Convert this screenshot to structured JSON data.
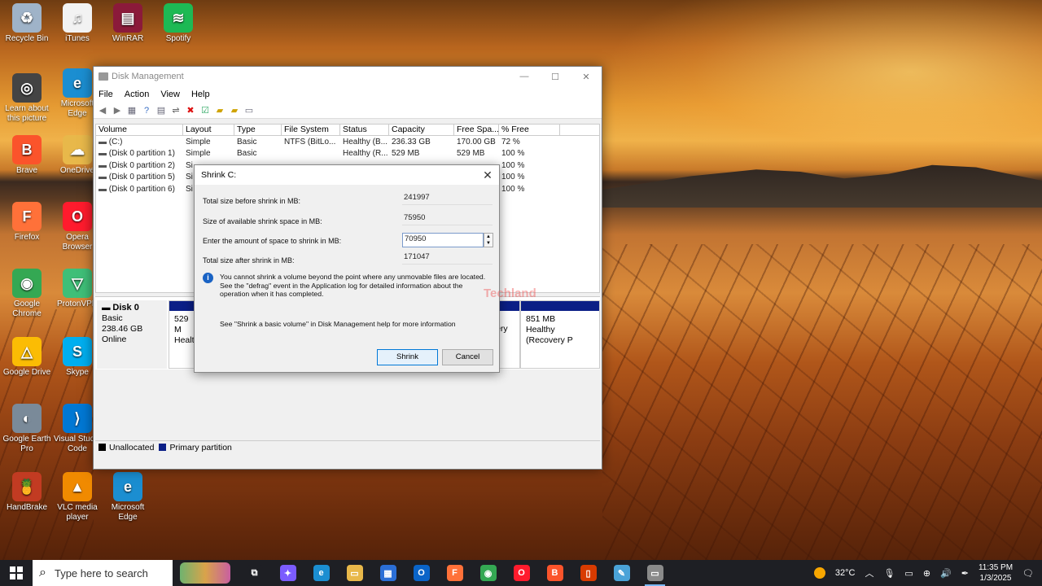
{
  "desktop_icons": [
    {
      "label": "Recycle Bin",
      "color": "#9fb3c8",
      "glyph": "♻"
    },
    {
      "label": "iTunes",
      "color": "#f2f2f2",
      "glyph": "♫"
    },
    {
      "label": "WinRAR",
      "color": "#8b1a3a",
      "glyph": "▤"
    },
    {
      "label": "Spotify",
      "color": "#1db954",
      "glyph": "≋"
    },
    {
      "label": "Learn about this picture",
      "color": "#444444",
      "glyph": "◎"
    },
    {
      "label": "Microsoft Edge",
      "color": "#1b8ed1",
      "glyph": "e"
    },
    {
      "label": "Brave",
      "color": "#fb542b",
      "glyph": "B"
    },
    {
      "label": "OneDrive",
      "color": "#e8b84a",
      "glyph": "☁"
    },
    {
      "label": "Firefox",
      "color": "#ff7139",
      "glyph": "F"
    },
    {
      "label": "Opera Browser",
      "color": "#ff1b2d",
      "glyph": "O"
    },
    {
      "label": "Google Chrome",
      "color": "#34a853",
      "glyph": "◉"
    },
    {
      "label": "ProtonVPN",
      "color": "#3fbf78",
      "glyph": "▽"
    },
    {
      "label": "Google Drive",
      "color": "#fbbc04",
      "glyph": "△"
    },
    {
      "label": "Skype",
      "color": "#00aff0",
      "glyph": "S"
    },
    {
      "label": "Google Earth Pro",
      "color": "#7a8a99",
      "glyph": "◐"
    },
    {
      "label": "Visual Studio Code",
      "color": "#0078d4",
      "glyph": "⟩"
    },
    {
      "label": "HandBrake",
      "color": "#c23b22",
      "glyph": "🍍"
    },
    {
      "label": "VLC media player",
      "color": "#f08a00",
      "glyph": "▲"
    },
    {
      "label": "Microsoft Edge",
      "color": "#1b8ed1",
      "glyph": "e"
    }
  ],
  "window": {
    "title": "Disk Management",
    "controls": {
      "minimize": "—",
      "maximize": "☐",
      "close": "✕"
    },
    "menu": [
      "File",
      "Action",
      "View",
      "Help"
    ],
    "columns": [
      "Volume",
      "Layout",
      "Type",
      "File System",
      "Status",
      "Capacity",
      "Free Spa...",
      "% Free"
    ],
    "rows": [
      [
        "(C:)",
        "Simple",
        "Basic",
        "NTFS (BitLo...",
        "Healthy (B...",
        "236.33 GB",
        "170.00 GB",
        "72 %"
      ],
      [
        "(Disk 0 partition 1)",
        "Simple",
        "Basic",
        "",
        "Healthy (R...",
        "529 MB",
        "529 MB",
        "100 %"
      ],
      [
        "(Disk 0 partition 2)",
        "Si",
        "",
        "",
        "",
        "",
        "",
        "100 %"
      ],
      [
        "(Disk 0 partition 5)",
        "Si",
        "",
        "",
        "",
        "",
        "",
        "100 %"
      ],
      [
        "(Disk 0 partition 6)",
        "Si",
        "",
        "",
        "",
        "",
        "",
        "100 %"
      ]
    ],
    "disk": {
      "name": "Disk 0",
      "type": "Basic",
      "size": "238.46 GB",
      "state": "Online"
    },
    "partitions": [
      {
        "size": "529 M",
        "status": "Health"
      },
      {
        "size": "",
        "status": "overy"
      },
      {
        "size": "851 MB",
        "status": "Healthy (Recovery P"
      }
    ],
    "legend": {
      "unallocated": "Unallocated",
      "primary": "Primary partition"
    }
  },
  "dialog": {
    "title": "Shrink C:",
    "close": "✕",
    "fields": [
      {
        "label": "Total size before shrink in MB:",
        "value": "241997"
      },
      {
        "label": "Size of available shrink space in MB:",
        "value": "75950"
      },
      {
        "label": "Enter the amount of space to shrink in MB:",
        "value": "70950"
      },
      {
        "label": "Total size after shrink in MB:",
        "value": "171047"
      }
    ],
    "info": "You cannot shrink a volume beyond the point where any unmovable files are located. See the \"defrag\" event in the Application log for detailed information about the operation when it has completed.",
    "help": "See \"Shrink a basic volume\" in Disk Management help for more information",
    "shrink_label": "Shrink",
    "cancel_label": "Cancel",
    "watermark": "Techland"
  },
  "taskbar": {
    "search_placeholder": "Type here to search",
    "apps": [
      {
        "name": "task-view",
        "color": "#1e1f24",
        "glyph": "⧉"
      },
      {
        "name": "copilot",
        "color": "#7b5cff",
        "glyph": "✦"
      },
      {
        "name": "edge",
        "color": "#1b8ed1",
        "glyph": "e"
      },
      {
        "name": "file-explorer",
        "color": "#e8b84a",
        "glyph": "▭"
      },
      {
        "name": "store",
        "color": "#2b6fd6",
        "glyph": "▦"
      },
      {
        "name": "outlook",
        "color": "#0a64c8",
        "glyph": "O"
      },
      {
        "name": "firefox",
        "color": "#ff7139",
        "glyph": "F"
      },
      {
        "name": "chrome",
        "color": "#34a853",
        "glyph": "◉"
      },
      {
        "name": "opera",
        "color": "#ff1b2d",
        "glyph": "O"
      },
      {
        "name": "brave",
        "color": "#fb542b",
        "glyph": "B"
      },
      {
        "name": "office",
        "color": "#d83b01",
        "glyph": "▯"
      },
      {
        "name": "notepad",
        "color": "#4aa3d8",
        "glyph": "✎"
      },
      {
        "name": "disk-management",
        "color": "#8a8a8a",
        "glyph": "▭"
      }
    ],
    "weather": "32°C",
    "time": "11:35 PM",
    "date": "1/3/2025"
  }
}
